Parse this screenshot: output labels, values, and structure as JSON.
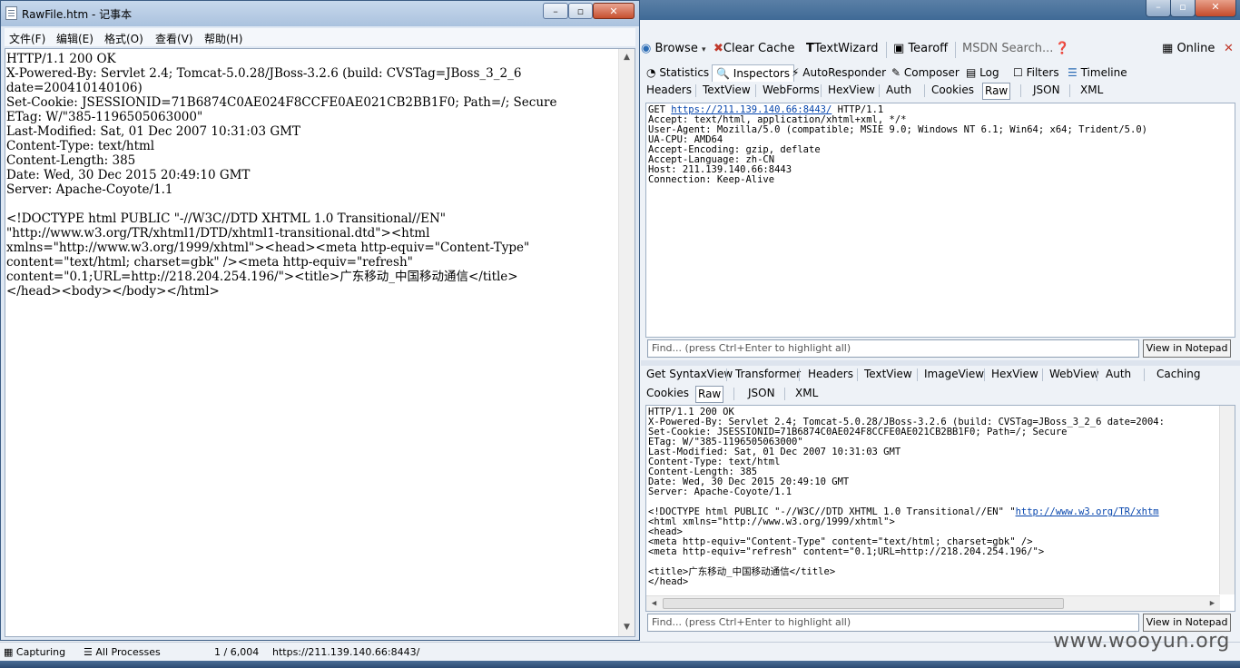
{
  "notepad": {
    "title": "RawFile.htm - 记事本",
    "menu": [
      "文件(F)",
      "编辑(E)",
      "格式(O)",
      "查看(V)",
      "帮助(H)"
    ],
    "content": "HTTP/1.1 200 OK\nX-Powered-By: Servlet 2.4; Tomcat-5.0.28/JBoss-3.2.6 (build: CVSTag=JBoss_3_2_6\ndate=200410140106)\nSet-Cookie: JSESSIONID=71B6874C0AE024F8CCFE0AE021CB2BB1F0; Path=/; Secure\nETag: W/\"385-1196505063000\"\nLast-Modified: Sat, 01 Dec 2007 10:31:03 GMT\nContent-Type: text/html\nContent-Length: 385\nDate: Wed, 30 Dec 2015 20:49:10 GMT\nServer: Apache-Coyote/1.1\n\n<!DOCTYPE html PUBLIC \"-//W3C//DTD XHTML 1.0 Transitional//EN\"\n\"http://www.w3.org/TR/xhtml1/DTD/xhtml1-transitional.dtd\"><html\nxmlns=\"http://www.w3.org/1999/xhtml\"><head><meta http-equiv=\"Content-Type\"\ncontent=\"text/html; charset=gbk\" /><meta http-equiv=\"refresh\"\ncontent=\"0.1;URL=http://218.204.254.196/\"><title>广东移动_中国移动通信</title>\n</head><body></body></html>"
  },
  "fiddler": {
    "toolbar": {
      "browse": "Browse",
      "clear_cache": "Clear Cache",
      "textwizard": "TextWizard",
      "tearoff": "Tearoff",
      "msdn_search": "MSDN Search...",
      "online": "Online"
    },
    "inspector_tabs": [
      "Statistics",
      "Inspectors",
      "AutoResponder",
      "Composer",
      "Log",
      "Filters",
      "Timeline"
    ],
    "request_tabs": [
      "Headers",
      "TextView",
      "WebForms",
      "HexView",
      "Auth",
      "Cookies",
      "Raw",
      "JSON",
      "XML"
    ],
    "request": {
      "method": "GET",
      "url": "https://211.139.140.66:8443/",
      "protocol": "HTTP/1.1",
      "headers": "Accept: text/html, application/xhtml+xml, */*\nUser-Agent: Mozilla/5.0 (compatible; MSIE 9.0; Windows NT 6.1; Win64; x64; Trident/5.0)\nUA-CPU: AMD64\nAccept-Encoding: gzip, deflate\nAccept-Language: zh-CN\nHost: 211.139.140.66:8443\nConnection: Keep-Alive"
    },
    "find_placeholder": "Find... (press Ctrl+Enter to highlight all)",
    "view_in_notepad": "View in Notepad",
    "response_tabs_row1": [
      "Get SyntaxView",
      "Transformer",
      "Headers",
      "TextView",
      "ImageView",
      "HexView",
      "WebView",
      "Auth",
      "Caching"
    ],
    "response_tabs_row2": [
      "Cookies",
      "Raw",
      "JSON",
      "XML"
    ],
    "response": {
      "head": "HTTP/1.1 200 OK\nX-Powered-By: Servlet 2.4; Tomcat-5.0.28/JBoss-3.2.6 (build: CVSTag=JBoss_3_2_6 date=2004:\nSet-Cookie: JSESSIONID=71B6874C0AE024F8CCFE0AE021CB2BB1F0; Path=/; Secure\nETag: W/\"385-1196505063000\"\nLast-Modified: Sat, 01 Dec 2007 10:31:03 GMT\nContent-Type: text/html\nContent-Length: 385\nDate: Wed, 30 Dec 2015 20:49:10 GMT\nServer: Apache-Coyote/1.1\n",
      "doctype_prefix": "<!DOCTYPE html PUBLIC \"-//W3C//DTD XHTML 1.0 Transitional//EN\" \"",
      "doctype_link": "http://www.w3.org/TR/xhtm",
      "body": "<html xmlns=\"http://www.w3.org/1999/xhtml\">\n<head>\n<meta http-equiv=\"Content-Type\" content=\"text/html; charset=gbk\" />\n<meta http-equiv=\"refresh\" content=\"0.1;URL=http://218.204.254.196/\">\n\n<title>广东移动_中国移动通信</title>\n</head>"
    },
    "status": {
      "capturing": "Capturing",
      "processes": "All Processes",
      "count": "1 / 6,004",
      "url": "https://211.139.140.66:8443/"
    },
    "watermark": "www.wooyun.org"
  }
}
